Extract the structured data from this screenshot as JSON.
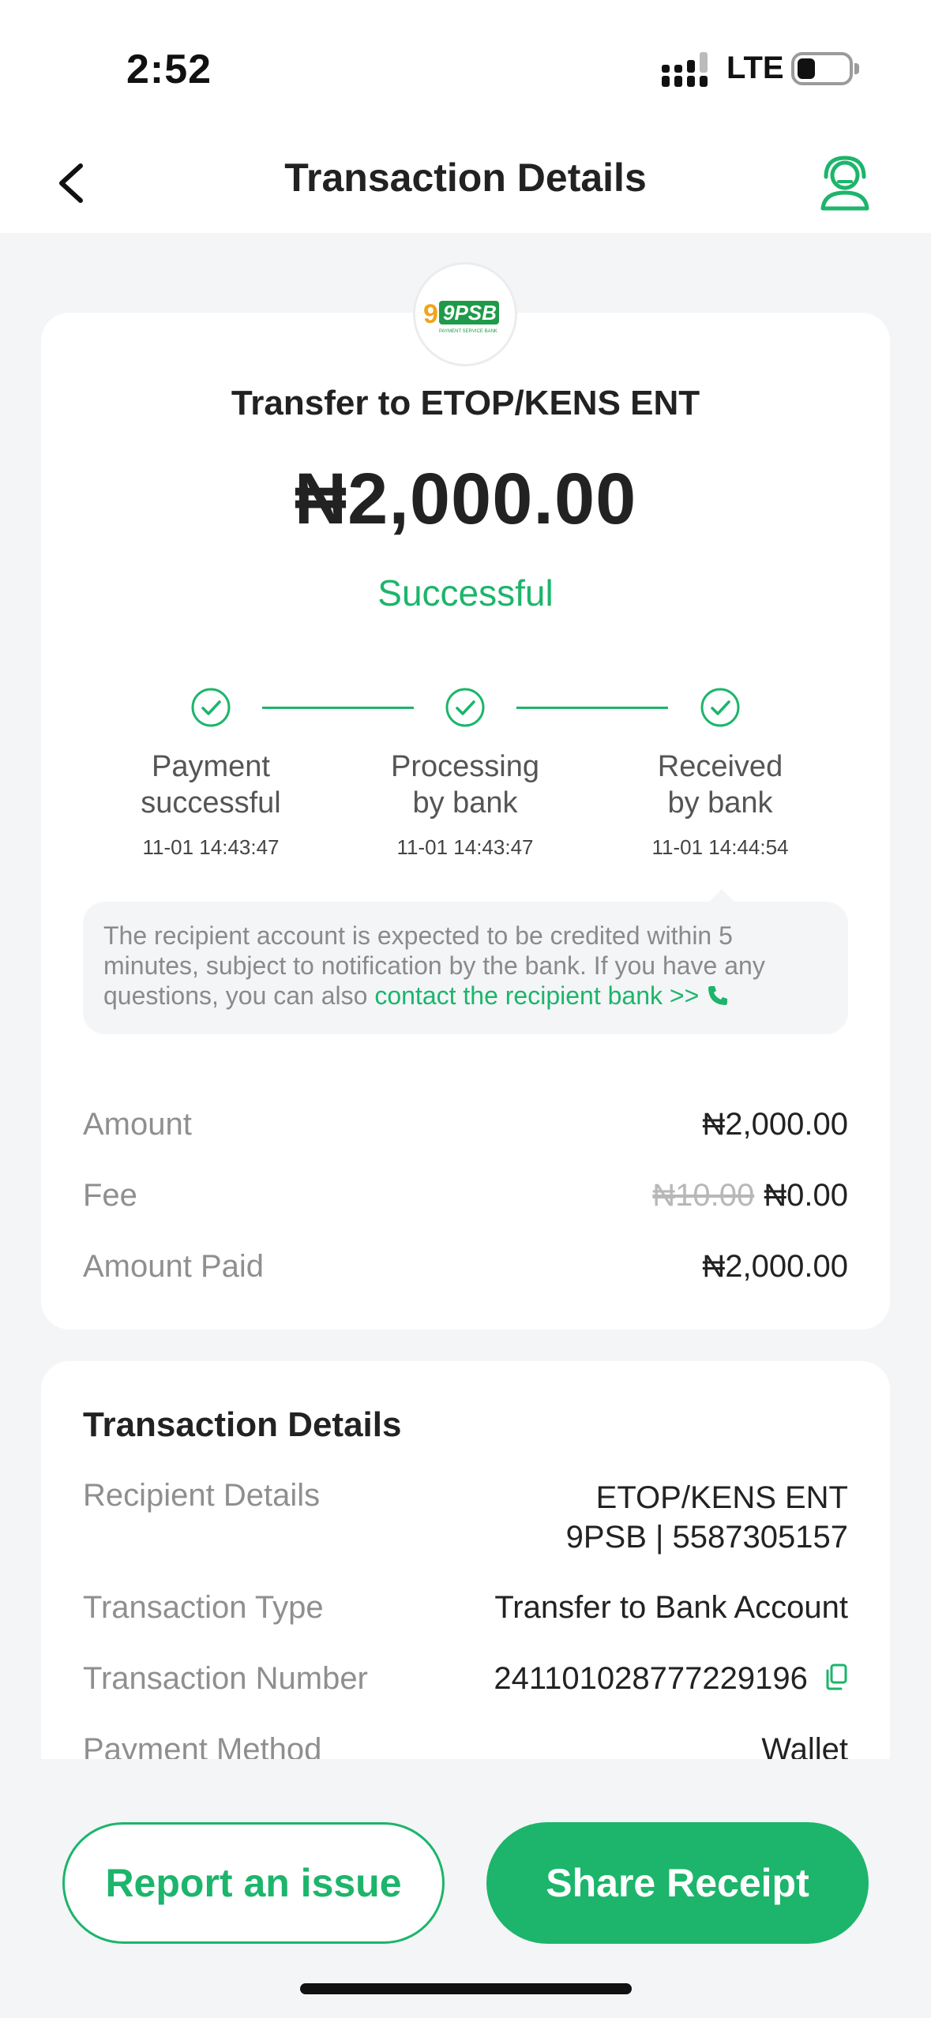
{
  "status_bar": {
    "time": "2:52",
    "network": "LTE"
  },
  "nav": {
    "title": "Transaction Details",
    "back_icon": "chevron-left-icon",
    "support_icon": "customer-support-icon"
  },
  "bank": {
    "logo_text": "9PSB",
    "logo_subtext": "PAYMENT SERVICE BANK",
    "brand_color": "#1cb56b"
  },
  "transfer": {
    "title": "Transfer to ETOP/KENS ENT",
    "amount": "₦2,000.00",
    "status": "Successful"
  },
  "progress": {
    "steps": [
      {
        "label_line1": "Payment",
        "label_line2": "successful",
        "time": "11-01 14:43:47"
      },
      {
        "label_line1": "Processing",
        "label_line2": "by bank",
        "time": "11-01 14:43:47"
      },
      {
        "label_line1": "Received",
        "label_line2": "by bank",
        "time": "11-01 14:44:54"
      }
    ]
  },
  "note": {
    "text": "The recipient account is expected to be credited within 5 minutes, subject to notification by the bank. If you have any questions, you can also ",
    "link": "contact the recipient bank >>"
  },
  "summary": {
    "amount_label": "Amount",
    "amount_value": "₦2,000.00",
    "fee_label": "Fee",
    "fee_original": "₦10.00",
    "fee_value": "₦0.00",
    "paid_label": "Amount Paid",
    "paid_value": "₦2,000.00"
  },
  "details": {
    "section_title": "Transaction Details",
    "recipient_label": "Recipient Details",
    "recipient_name": "ETOP/KENS ENT",
    "recipient_account": "9PSB | 5587305157",
    "type_label": "Transaction Type",
    "type_value": "Transfer to Bank Account",
    "number_label": "Transaction Number",
    "number_value": "241101028777229196",
    "method_label": "Payment Method",
    "method_value": "Wallet"
  },
  "actions": {
    "report_label": "Report an issue",
    "share_label": "Share Receipt"
  }
}
